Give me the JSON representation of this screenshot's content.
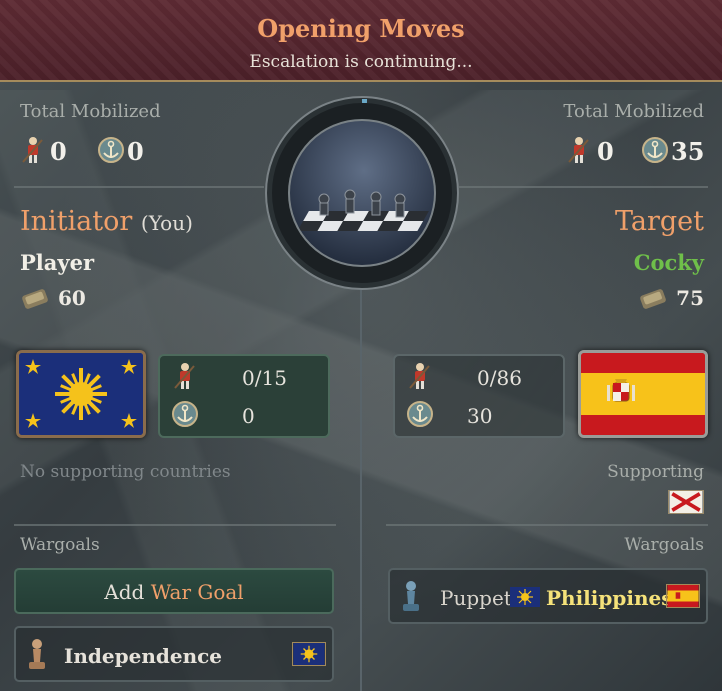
{
  "header": {
    "title": "Opening Moves",
    "subtitle": "Escalation is continuing..."
  },
  "initiator": {
    "total_mobilized_label": "Total Mobilized",
    "army_mobilized": "0",
    "navy_mobilized": "0",
    "side_label": "Initiator",
    "you_label": "(You)",
    "attitude": "Player",
    "attitude_color": "#f2efe6",
    "diplomatic_stat": "60",
    "army_ratio": "0/15",
    "navy_value": "0",
    "supporting_text": "No supporting countries",
    "wargoals_label": "Wargoals",
    "add_button_prefix": "Add",
    "add_button_highlight": "War Goal",
    "wargoal": {
      "name": "Independence"
    }
  },
  "target": {
    "total_mobilized_label": "Total Mobilized",
    "army_mobilized": "0",
    "navy_mobilized": "35",
    "side_label": "Target",
    "attitude": "Cocky",
    "attitude_color": "#6fbf4a",
    "diplomatic_stat": "75",
    "army_ratio": "0/86",
    "navy_value": "30",
    "supporting_label": "Supporting",
    "wargoals_label": "Wargoals",
    "wargoal": {
      "type": "Puppet",
      "country": "Philippines"
    }
  },
  "colors": {
    "accent_orange": "#f0a06a",
    "header_bg": "#5e2b34",
    "cocky_green": "#6fbf4a",
    "philippines_yellow": "#f5e27a"
  },
  "icons": {
    "army": "soldier-icon",
    "navy": "anchor-icon",
    "stat": "scroll-icon",
    "wargoal": "pawn-icon",
    "center": "chess-board-icon"
  }
}
